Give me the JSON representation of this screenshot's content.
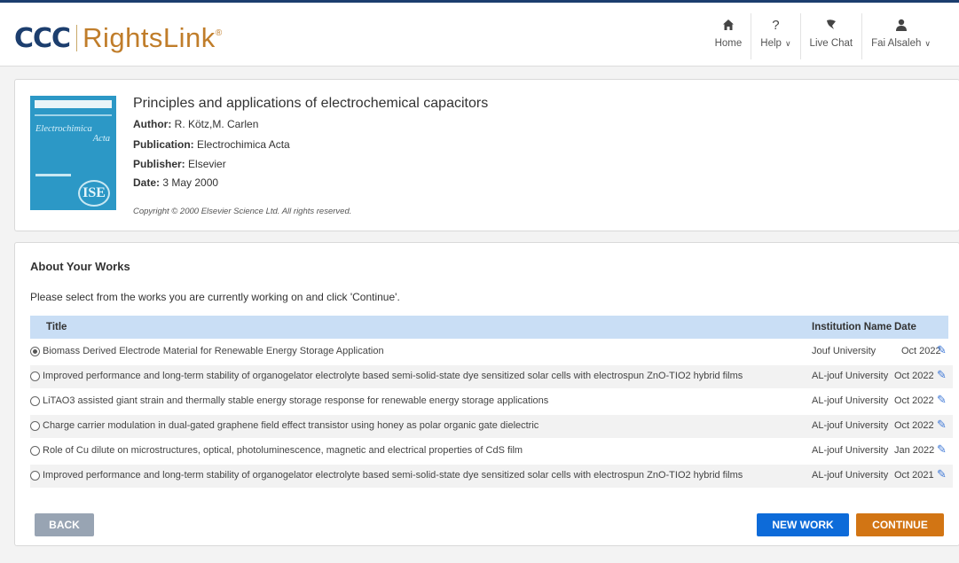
{
  "header": {
    "logo_ccc": "CCC",
    "logo_product": "RightsLink",
    "logo_reg": "®",
    "nav": [
      {
        "label": "Home",
        "icon": "home-icon"
      },
      {
        "label": "Help",
        "icon": "question-icon"
      },
      {
        "label": "Live Chat",
        "icon": "chat-icon"
      },
      {
        "label": "Fai Alsaleh",
        "icon": "user-icon"
      }
    ]
  },
  "article": {
    "title": "Principles and applications of electrochemical capacitors",
    "author_label": "Author:",
    "author": "R. Kötz,M. Carlen",
    "publication_label": "Publication:",
    "publication": "Electrochimica Acta",
    "publisher_label": "Publisher:",
    "publisher": "Elsevier",
    "date_label": "Date:",
    "date": "3 May 2000",
    "copyright": "Copyright © 2000 Elsevier Science Ltd. All rights reserved.",
    "cover_title": "Electrochimica",
    "cover_title2": "Acta",
    "cover_badge": "ISE"
  },
  "works": {
    "section_title": "About Your Works",
    "instruction": "Please select from the works you are currently working on and click 'Continue'.",
    "columns": {
      "title": "Title",
      "institution": "Institution Name",
      "date": "Date"
    },
    "rows": [
      {
        "title": "Biomass Derived Electrode Material for Renewable Energy Storage Application",
        "institution": "Jouf University",
        "date": "Oct 2022",
        "selected": true
      },
      {
        "title": "Improved performance and long-term stability of organogelator electrolyte based semi-solid-state dye sensitized solar cells with electrospun ZnO-TIO2 hybrid films",
        "institution": "AL-jouf University",
        "date": "Oct 2022",
        "selected": false
      },
      {
        "title": "LiTAO3 assisted giant strain and thermally stable energy storage response for renewable energy storage applications",
        "institution": "AL-jouf University",
        "date": "Oct 2022",
        "selected": false
      },
      {
        "title": "Charge carrier modulation in dual-gated graphene field effect transistor using honey as polar organic gate dielectric",
        "institution": "AL-jouf University",
        "date": "Oct 2022",
        "selected": false
      },
      {
        "title": "Role of Cu dilute on microstructures, optical, photoluminescence, magnetic and electrical properties of CdS film",
        "institution": "AL-jouf University",
        "date": "Jan 2022",
        "selected": false
      },
      {
        "title": "Improved performance and long-term stability of organogelator electrolyte based semi-solid-state dye sensitized solar cells with electrospun ZnO-TIO2 hybrid films",
        "institution": "AL-jouf University",
        "date": "Oct 2021",
        "selected": false
      }
    ]
  },
  "buttons": {
    "back": "BACK",
    "new_work": "NEW WORK",
    "continue": "CONTINUE"
  },
  "colors": {
    "brand_navy": "#1c3e6e",
    "brand_orange": "#c07d2a",
    "new_work": "#0d6bd9",
    "continue": "#d27514",
    "back": "#98a4b3",
    "table_header": "#c9def5"
  }
}
